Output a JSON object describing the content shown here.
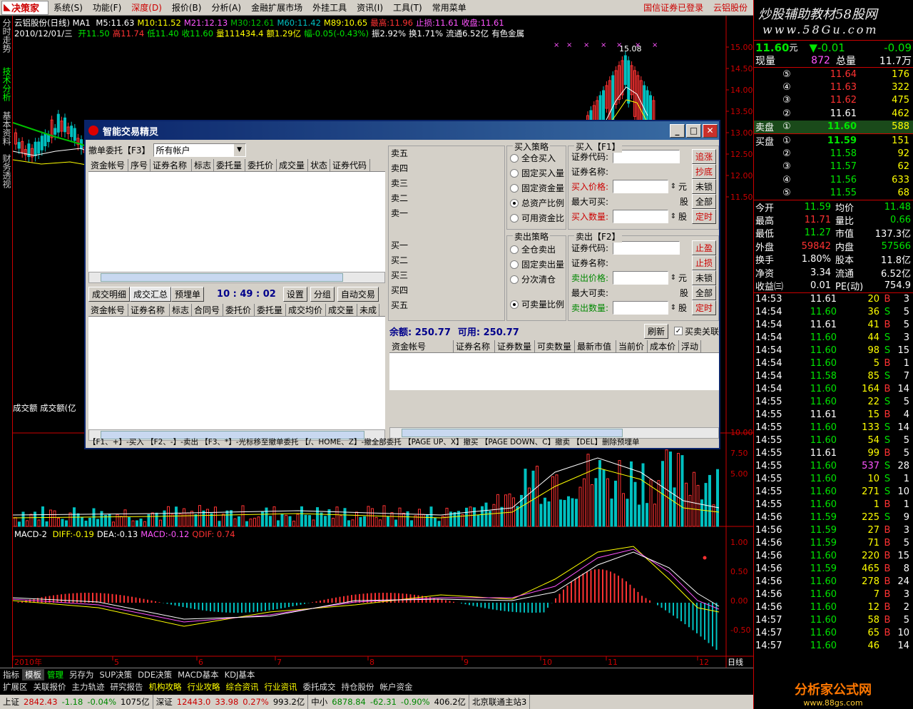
{
  "menubar": {
    "logo": "决策家",
    "items": [
      "系统(S)",
      "功能(F)",
      "深度(D)",
      "报价(B)",
      "分析(A)",
      "金融扩展市场",
      "外挂工具",
      "资讯(I)",
      "工具(T)",
      "常用菜单"
    ],
    "status_login": "国信证券已登录",
    "status_stock": "云铝股份"
  },
  "vtabs": [
    "分时走势",
    "技术分析",
    "基本资料",
    "财务透视"
  ],
  "chart": {
    "title": "云铝股份(日线)",
    "ma_label": "MA1",
    "ma_values": [
      {
        "label": "M5:11.63",
        "color": "#ffffff"
      },
      {
        "label": "M10:11.52",
        "color": "#ffff00"
      },
      {
        "label": "M21:12.13",
        "color": "#ff55ff"
      },
      {
        "label": "M30:12.61",
        "color": "#00c000"
      },
      {
        "label": "M60:11.42",
        "color": "#00c0c0"
      },
      {
        "label": "M89:10.65",
        "color": "#ffff00"
      },
      {
        "label": "最高:11.96",
        "color": "#ff3232"
      },
      {
        "label": "止损:11.61",
        "color": "#ff55ff"
      },
      {
        "label": "收盘:11.61",
        "color": "#ff55ff"
      }
    ],
    "day_line": "2010/12/01/三",
    "day_values": [
      {
        "label": "开11.50",
        "color": "#00e600"
      },
      {
        "label": "高11.74",
        "color": "#ff3232"
      },
      {
        "label": "低11.40",
        "color": "#00e600"
      },
      {
        "label": "收11.60",
        "color": "#00e600"
      },
      {
        "label": "量111434.4",
        "color": "#ffff00"
      },
      {
        "label": "额1.29亿",
        "color": "#ffff00"
      },
      {
        "label": "幅-0.05(-0.43%)",
        "color": "#00e600"
      },
      {
        "label": "振2.92%",
        "color": "#ffffff"
      },
      {
        "label": "换1.71%",
        "color": "#ffffff"
      },
      {
        "label": "流通6.52亿",
        "color": "#ffffff"
      },
      {
        "label": "有色金属",
        "color": "#ffffff"
      }
    ],
    "price_axis": [
      "15.00",
      "14.50",
      "14.00",
      "13.50",
      "13.00",
      "12.50",
      "12.00",
      "11.50"
    ],
    "peak_label": "15.08",
    "volume_label": "成交额 成交额(亿",
    "volume_axis": [
      "10.00",
      "7.50",
      "5.00"
    ],
    "macd_label": "MACD-2",
    "macd_values": [
      {
        "label": "DIFF:-0.19",
        "color": "#ffff00"
      },
      {
        "label": "DEA:-0.13",
        "color": "#ffffff"
      },
      {
        "label": "MACD:-0.12",
        "color": "#ff55ff"
      },
      {
        "label": "QDIF: 0.74",
        "color": "#ff3232"
      }
    ],
    "macd_axis": [
      "1.00",
      "0.50",
      "0.00",
      "-0.50"
    ],
    "date_axis": [
      "2010年",
      "5",
      "6",
      "7",
      "8",
      "9",
      "10",
      "11",
      "12"
    ],
    "period": "日线"
  },
  "dialog": {
    "title": "智能交易精灵",
    "cancel_label": "撤单委托【F3】",
    "account_select": "所有帐户",
    "order_cols": [
      "资金帐号",
      "序号",
      "证券名称",
      "标志",
      "委托量",
      "委托价",
      "成交量",
      "状态",
      "证券代码"
    ],
    "tabs": [
      "成交明细",
      "成交汇总",
      "预埋单"
    ],
    "time": "10 : 49 : 02",
    "tool_buttons": [
      "设置",
      "分组",
      "自动交易"
    ],
    "fill_cols": [
      "资金帐号",
      "证券名称",
      "标志",
      "合同号",
      "委托价",
      "委托量",
      "成交均价",
      "成交量",
      "未成"
    ],
    "sell_levels": [
      "卖五",
      "卖四",
      "卖三",
      "卖二",
      "卖一"
    ],
    "buy_levels": [
      "买一",
      "买二",
      "买三",
      "买四",
      "买五"
    ],
    "buy_strategy_title": "买入策略",
    "buy_strategies": [
      "全仓买入",
      "固定买入量",
      "固定资金量",
      "总资产比例",
      "可用资金比"
    ],
    "buy_title": "买入【F1】",
    "buy_fields": [
      "证券代码:",
      "证券名称:",
      "买入价格:",
      "最大可买:",
      "买入数量:"
    ],
    "buy_buttons": [
      "追涨",
      "抄底",
      "未锁",
      "全部",
      "定时"
    ],
    "sell_strategy_title": "卖出策略",
    "sell_strategies": [
      "全仓卖出",
      "固定卖出量",
      "分次清仓",
      "可卖量比例"
    ],
    "sell_title": "卖出【F2】",
    "sell_fields": [
      "证券代码:",
      "证券名称:",
      "卖出价格:",
      "最大可卖:",
      "卖出数量:"
    ],
    "sell_buttons": [
      "止盈",
      "止损",
      "未锁",
      "全部",
      "定时"
    ],
    "unit_yuan": "元",
    "unit_gu": "股",
    "balance": "余额: 250.77",
    "available": "可用: 250.77",
    "refresh": "刷新",
    "linked": "买卖关联",
    "position_cols": [
      "资金帐号",
      "证券名称",
      "证券数量",
      "可卖数量",
      "最新市值",
      "当前价",
      "成本价",
      "浮动"
    ],
    "hint": "【F1、+】-买入  【F2、-】-卖出  【F3、*】-光标移至撤单委托  【/、HOME、Z】-撤全部委托  【PAGE UP、X】撤买  【PAGE DOWN、C】撤卖  【DEL】删除预埋单"
  },
  "rpanel": {
    "watermark1": "炒股辅助教材58股网",
    "watermark2": "www.58Gu.com",
    "price": "11.60",
    "price_unit": "元",
    "change": "▼-0.01",
    "change_pct": "-0.09",
    "now_vol_label": "现量",
    "now_vol": "872",
    "total_label": "总量",
    "total": "11.7万",
    "asks": [
      {
        "lvl": "⑤",
        "price": "11.64",
        "vol": "176"
      },
      {
        "lvl": "④",
        "price": "11.63",
        "vol": "322"
      },
      {
        "lvl": "③",
        "price": "11.62",
        "vol": "475"
      },
      {
        "lvl": "②",
        "price": "11.61",
        "vol": "462"
      },
      {
        "lvl": "①",
        "price": "11.60",
        "vol": "588"
      }
    ],
    "ask_label": "卖盘",
    "bid_label": "买盘",
    "bids": [
      {
        "lvl": "①",
        "price": "11.59",
        "vol": "151"
      },
      {
        "lvl": "②",
        "price": "11.58",
        "vol": "92"
      },
      {
        "lvl": "③",
        "price": "11.57",
        "vol": "62"
      },
      {
        "lvl": "④",
        "price": "11.56",
        "vol": "633"
      },
      {
        "lvl": "⑤",
        "price": "11.55",
        "vol": "68"
      }
    ],
    "stats": [
      {
        "l1": "今开",
        "v1": "11.59",
        "c1": "dn",
        "l2": "均价",
        "v2": "11.48",
        "c2": "dn"
      },
      {
        "l1": "最高",
        "v1": "11.71",
        "c1": "up",
        "l2": "量比",
        "v2": "0.66",
        "c2": "dn"
      },
      {
        "l1": "最低",
        "v1": "11.27",
        "c1": "dn",
        "l2": "市值",
        "v2": "137.3亿",
        "c2": "wh"
      },
      {
        "l1": "外盘",
        "v1": "59842",
        "c1": "up",
        "l2": "内盘",
        "v2": "57566",
        "c2": "dn"
      },
      {
        "l1": "换手",
        "v1": "1.80%",
        "c1": "wh",
        "l2": "股本",
        "v2": "11.8亿",
        "c2": "wh"
      },
      {
        "l1": "净资",
        "v1": "3.34",
        "c1": "wh",
        "l2": "流通",
        "v2": "6.52亿",
        "c2": "wh"
      },
      {
        "l1": "收益㈢",
        "v1": "0.01",
        "c1": "wh",
        "l2": "PE(动)",
        "v2": "754.9",
        "c2": "wh"
      }
    ],
    "ticks": [
      {
        "t": "14:53",
        "p": "11.61",
        "pc": "wh",
        "v": "20",
        "s": "B",
        "n": "3"
      },
      {
        "t": "14:54",
        "p": "11.60",
        "pc": "dn",
        "v": "36",
        "s": "S",
        "n": "5"
      },
      {
        "t": "14:54",
        "p": "11.61",
        "pc": "wh",
        "v": "41",
        "s": "B",
        "n": "5"
      },
      {
        "t": "14:54",
        "p": "11.60",
        "pc": "dn",
        "v": "44",
        "s": "S",
        "n": "3"
      },
      {
        "t": "14:54",
        "p": "11.60",
        "pc": "dn",
        "v": "98",
        "s": "S",
        "n": "15"
      },
      {
        "t": "14:54",
        "p": "11.60",
        "pc": "dn",
        "v": "5",
        "s": "B",
        "n": "1"
      },
      {
        "t": "14:54",
        "p": "11.58",
        "pc": "dn",
        "v": "85",
        "s": "S",
        "n": "7"
      },
      {
        "t": "14:54",
        "p": "11.60",
        "pc": "dn",
        "v": "164",
        "s": "B",
        "n": "14"
      },
      {
        "t": "14:55",
        "p": "11.60",
        "pc": "dn",
        "v": "22",
        "s": "S",
        "n": "5"
      },
      {
        "t": "14:55",
        "p": "11.61",
        "pc": "wh",
        "v": "15",
        "s": "B",
        "n": "4"
      },
      {
        "t": "14:55",
        "p": "11.60",
        "pc": "dn",
        "v": "133",
        "s": "S",
        "n": "14"
      },
      {
        "t": "14:55",
        "p": "11.60",
        "pc": "dn",
        "v": "54",
        "s": "S",
        "n": "5"
      },
      {
        "t": "14:55",
        "p": "11.61",
        "pc": "wh",
        "v": "99",
        "s": "B",
        "n": "5"
      },
      {
        "t": "14:55",
        "p": "11.60",
        "pc": "dn",
        "v": "537",
        "s": "S",
        "n": "28"
      },
      {
        "t": "14:55",
        "p": "11.60",
        "pc": "dn",
        "v": "10",
        "s": "S",
        "n": "1"
      },
      {
        "t": "14:55",
        "p": "11.60",
        "pc": "dn",
        "v": "271",
        "s": "S",
        "n": "10"
      },
      {
        "t": "14:55",
        "p": "11.60",
        "pc": "dn",
        "v": "1",
        "s": "B",
        "n": "1"
      },
      {
        "t": "14:56",
        "p": "11.59",
        "pc": "dn",
        "v": "225",
        "s": "S",
        "n": "9"
      },
      {
        "t": "14:56",
        "p": "11.59",
        "pc": "dn",
        "v": "27",
        "s": "B",
        "n": "3"
      },
      {
        "t": "14:56",
        "p": "11.59",
        "pc": "dn",
        "v": "71",
        "s": "B",
        "n": "5"
      },
      {
        "t": "14:56",
        "p": "11.60",
        "pc": "dn",
        "v": "220",
        "s": "B",
        "n": "15"
      },
      {
        "t": "14:56",
        "p": "11.59",
        "pc": "dn",
        "v": "465",
        "s": "B",
        "n": "8"
      },
      {
        "t": "14:56",
        "p": "11.60",
        "pc": "dn",
        "v": "278",
        "s": "B",
        "n": "24"
      },
      {
        "t": "14:56",
        "p": "11.60",
        "pc": "dn",
        "v": "7",
        "s": "B",
        "n": "3"
      },
      {
        "t": "14:56",
        "p": "11.60",
        "pc": "dn",
        "v": "12",
        "s": "B",
        "n": "2"
      },
      {
        "t": "14:57",
        "p": "11.60",
        "pc": "dn",
        "v": "58",
        "s": "B",
        "n": "5"
      },
      {
        "t": "14:57",
        "p": "11.60",
        "pc": "dn",
        "v": "65",
        "s": "B",
        "n": "10"
      },
      {
        "t": "14:57",
        "p": "11.60",
        "pc": "dn",
        "v": "46",
        "s": "",
        "n": "14"
      }
    ],
    "bottom_logo": "分析家公式网",
    "bottom_url": "www.88gs.com"
  },
  "tabbar1": [
    "指标",
    "模板",
    "管理",
    "另存为",
    "SUP决策",
    "DDE决策",
    "MACD基本",
    "KDJ基本"
  ],
  "tabbar2": [
    "扩展区",
    "关联报价",
    "主力轨迹",
    "研究报告",
    "机构攻略",
    "行业攻略",
    "综合资讯",
    "行业资讯",
    "委托成交",
    "持仓股份",
    "帐户资金"
  ],
  "statusbar": {
    "sh_label": "上证",
    "sh_val": "2842.43",
    "sh_chg": "-1.18",
    "sh_pct": "-0.04%",
    "sh_amt": "1075亿",
    "sz_label": "深证",
    "sz_val": "12443.0",
    "sz_chg": "33.98",
    "sz_pct": "0.27%",
    "sz_amt": "993.2亿",
    "zx_label": "中小",
    "zx_val": "6878.84",
    "zx_chg": "-62.31",
    "zx_pct": "-0.90%",
    "zx_amt": "406.2亿",
    "server": "北京联通主站3"
  }
}
